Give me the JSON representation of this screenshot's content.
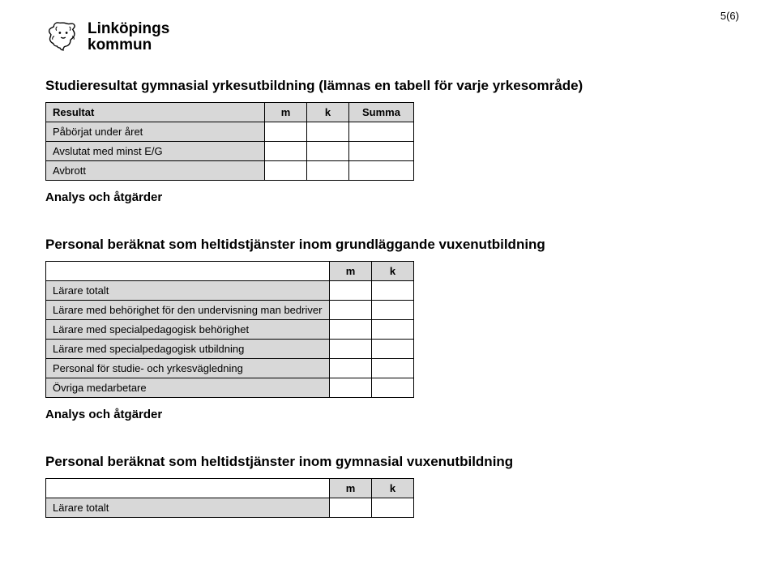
{
  "page_number": "5(6)",
  "logo": {
    "line1": "Linköpings",
    "line2": "kommun"
  },
  "section1": {
    "title": "Studieresultat gymnasial yrkesutbildning (lämnas en tabell för varje yrkesområde)",
    "header": {
      "col1": "Resultat",
      "m": "m",
      "k": "k",
      "summa": "Summa"
    },
    "rows": [
      "Påbörjat under året",
      "Avslutat med minst E/G",
      "Avbrott"
    ],
    "analys": "Analys och åtgärder"
  },
  "section2": {
    "title": "Personal beräknat som heltidstjänster inom grundläggande vuxenutbildning",
    "header": {
      "m": "m",
      "k": "k"
    },
    "rows": [
      "Lärare totalt",
      "Lärare med behörighet för den undervisning man bedriver",
      "Lärare med specialpedagogisk behörighet",
      "Lärare med specialpedagogisk utbildning",
      "Personal för studie- och yrkesvägledning",
      "Övriga medarbetare"
    ],
    "analys": "Analys och åtgärder"
  },
  "section3": {
    "title": "Personal beräknat som heltidstjänster inom gymnasial vuxenutbildning",
    "header": {
      "m": "m",
      "k": "k"
    },
    "rows": [
      "Lärare totalt"
    ]
  }
}
